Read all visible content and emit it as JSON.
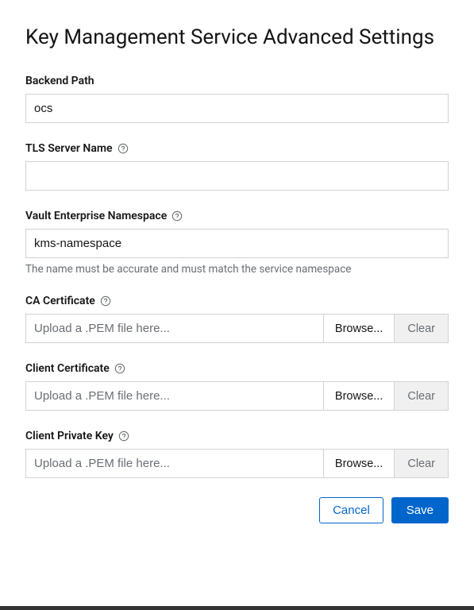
{
  "title": "Key Management Service Advanced Settings",
  "fields": {
    "backendPath": {
      "label": "Backend Path",
      "value": "ocs"
    },
    "tlsServerName": {
      "label": "TLS Server Name",
      "value": ""
    },
    "vaultNamespace": {
      "label": "Vault Enterprise Namespace",
      "value": "kms-namespace",
      "helper": "The name must be accurate and must match the service namespace"
    },
    "caCertificate": {
      "label": "CA Certificate",
      "placeholder": "Upload a .PEM file here...",
      "browse": "Browse...",
      "clear": "Clear"
    },
    "clientCertificate": {
      "label": "Client Certificate",
      "placeholder": "Upload a .PEM file here...",
      "browse": "Browse...",
      "clear": "Clear"
    },
    "clientPrivateKey": {
      "label": "Client Private Key",
      "placeholder": "Upload a .PEM file here...",
      "browse": "Browse...",
      "clear": "Clear"
    }
  },
  "actions": {
    "cancel": "Cancel",
    "save": "Save"
  }
}
